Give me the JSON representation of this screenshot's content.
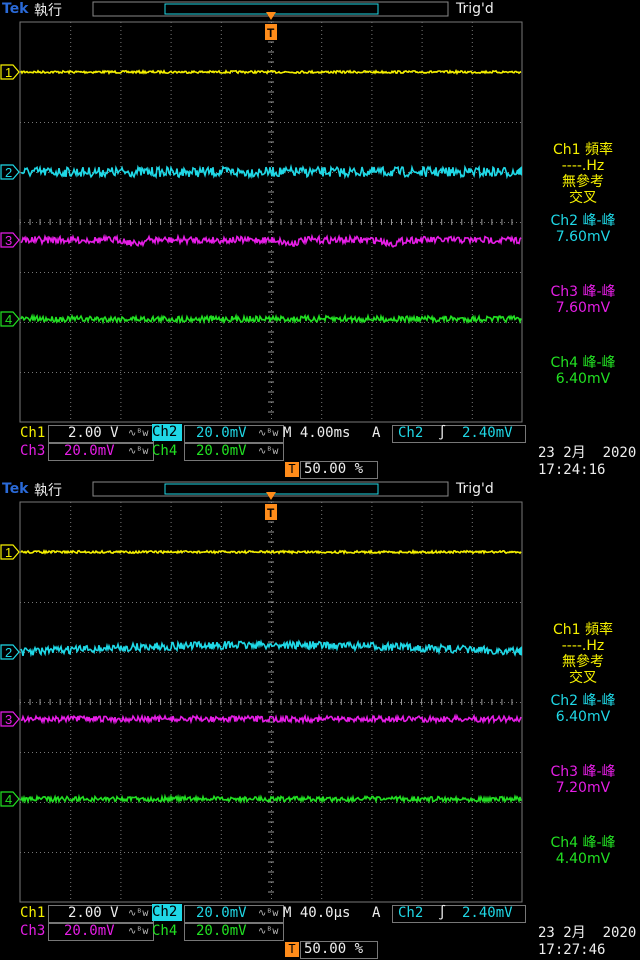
{
  "screens": [
    {
      "header": {
        "brand": "Tek",
        "state": "執行",
        "trigger_status": "Trig'd"
      },
      "side_panel": {
        "ch1_measure_title": "Ch1 頻率",
        "ch1_measure_value": "----.Hz",
        "ch1_note_1": "無參考",
        "ch1_note_2": "交叉",
        "ch2_measure_title": "Ch2 峰-峰",
        "ch2_measure_value": "7.60mV",
        "ch3_measure_title": "Ch3 峰-峰",
        "ch3_measure_value": "7.60mV",
        "ch4_measure_title": "Ch4 峰-峰",
        "ch4_measure_value": "6.40mV"
      },
      "footer": {
        "ch1_label": "Ch1",
        "ch1_scale": "2.00 V",
        "ch2_label": "Ch2",
        "ch2_scale": "20.0mV",
        "ch3_label": "Ch3",
        "ch3_scale": "20.0mV",
        "ch4_label": "Ch4",
        "ch4_scale": "20.0mV",
        "bw_symbol": "∿ᴮw",
        "timebase": "M 4.00ms",
        "acq_mode": "A",
        "trig_source": "Ch2",
        "trig_slope": "∫",
        "trig_level": "2.40mV",
        "trig_position": "50.00 %",
        "date": "23 2月  2020",
        "time": "17:24:16"
      },
      "markers": {
        "ch1": "1",
        "ch2": "2",
        "ch3": "3",
        "ch4": "4",
        "trigger": "T"
      }
    },
    {
      "header": {
        "brand": "Tek",
        "state": "執行",
        "trigger_status": "Trig'd"
      },
      "side_panel": {
        "ch1_measure_title": "Ch1 頻率",
        "ch1_measure_value": "----.Hz",
        "ch1_note_1": "無參考",
        "ch1_note_2": "交叉",
        "ch2_measure_title": "Ch2 峰-峰",
        "ch2_measure_value": "6.40mV",
        "ch3_measure_title": "Ch3 峰-峰",
        "ch3_measure_value": "7.20mV",
        "ch4_measure_title": "Ch4 峰-峰",
        "ch4_measure_value": "4.40mV"
      },
      "footer": {
        "ch1_label": "Ch1",
        "ch1_scale": "2.00 V",
        "ch2_label": "Ch2",
        "ch2_scale": "20.0mV",
        "ch3_label": "Ch3",
        "ch3_scale": "20.0mV",
        "ch4_label": "Ch4",
        "ch4_scale": "20.0mV",
        "bw_symbol": "∿ᴮw",
        "timebase": "M 40.0µs",
        "acq_mode": "A",
        "trig_source": "Ch2",
        "trig_slope": "∫",
        "trig_level": "2.40mV",
        "trig_position": "50.00 %",
        "date": "23 2月  2020",
        "time": "17:27:46"
      },
      "markers": {
        "ch1": "1",
        "ch2": "2",
        "ch3": "3",
        "ch4": "4",
        "trigger": "T"
      }
    }
  ],
  "colors": {
    "ch1": "#f5f000",
    "ch2": "#1fd8e6",
    "ch3": "#e61ee6",
    "ch4": "#22e022",
    "trigger": "#ff8c1a",
    "grid": "#8a8a8a"
  }
}
